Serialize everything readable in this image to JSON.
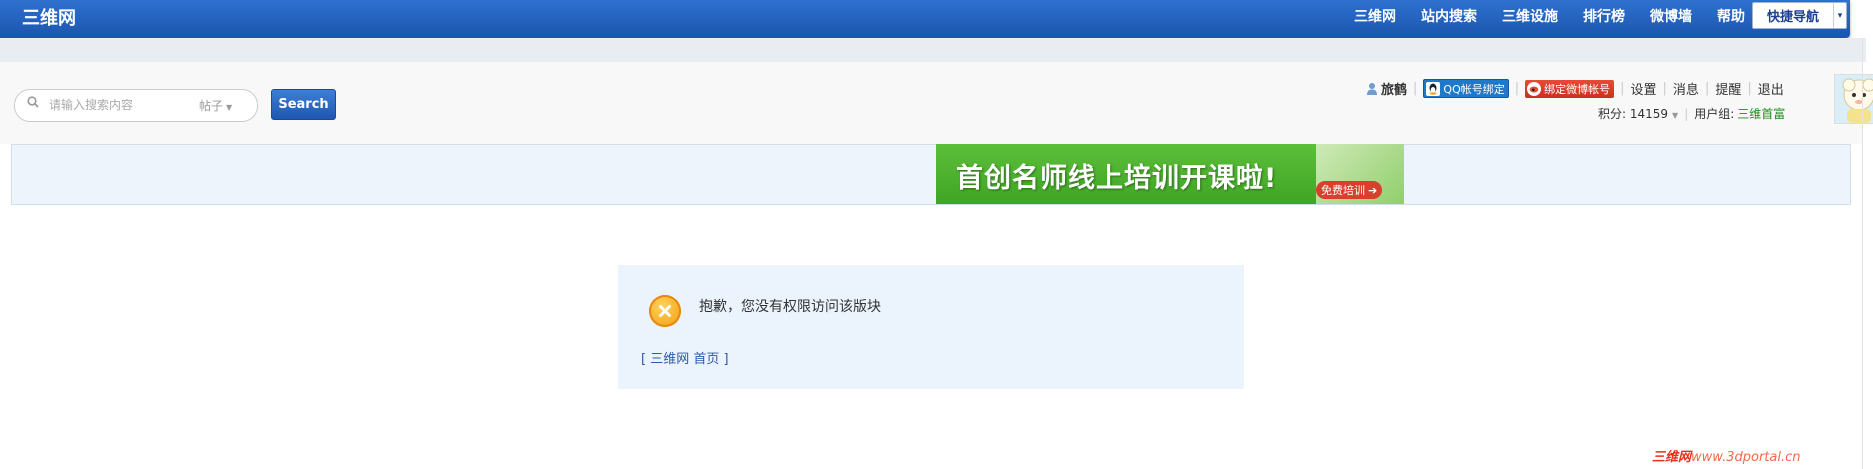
{
  "topbar": {
    "site_name": "三维网",
    "nav": [
      "三维网",
      "站内搜索",
      "三维设施",
      "排行榜",
      "微博墙",
      "帮助"
    ],
    "quicknav_label": "快捷导航"
  },
  "search": {
    "placeholder": "请输入搜索内容",
    "scope": "帖子",
    "button_label": "Search"
  },
  "user": {
    "username": "旅鹤",
    "qq_bind_label": "QQ帐号绑定",
    "weibo_bind_label": "绑定微博帐号",
    "links": [
      "设置",
      "消息",
      "提醒",
      "退出"
    ],
    "credits_label": "积分: 14159",
    "usergroup_label": "用户组:",
    "usergroup_value": "三维首富"
  },
  "banner": {
    "text": "首创名师线上培训开课啦!",
    "badge": "免费培训"
  },
  "message": {
    "text": "抱歉，您没有权限访问该版块",
    "link": "[ 三维网 首页 ]"
  },
  "watermark": {
    "brand": "三维网",
    "url": "www.3dportal.cn"
  },
  "colors": {
    "topbar": "#1f5fbf",
    "usergroup": "#1a8c1a",
    "message_bg": "#ebf3fc",
    "error_icon": "#f39a10"
  }
}
